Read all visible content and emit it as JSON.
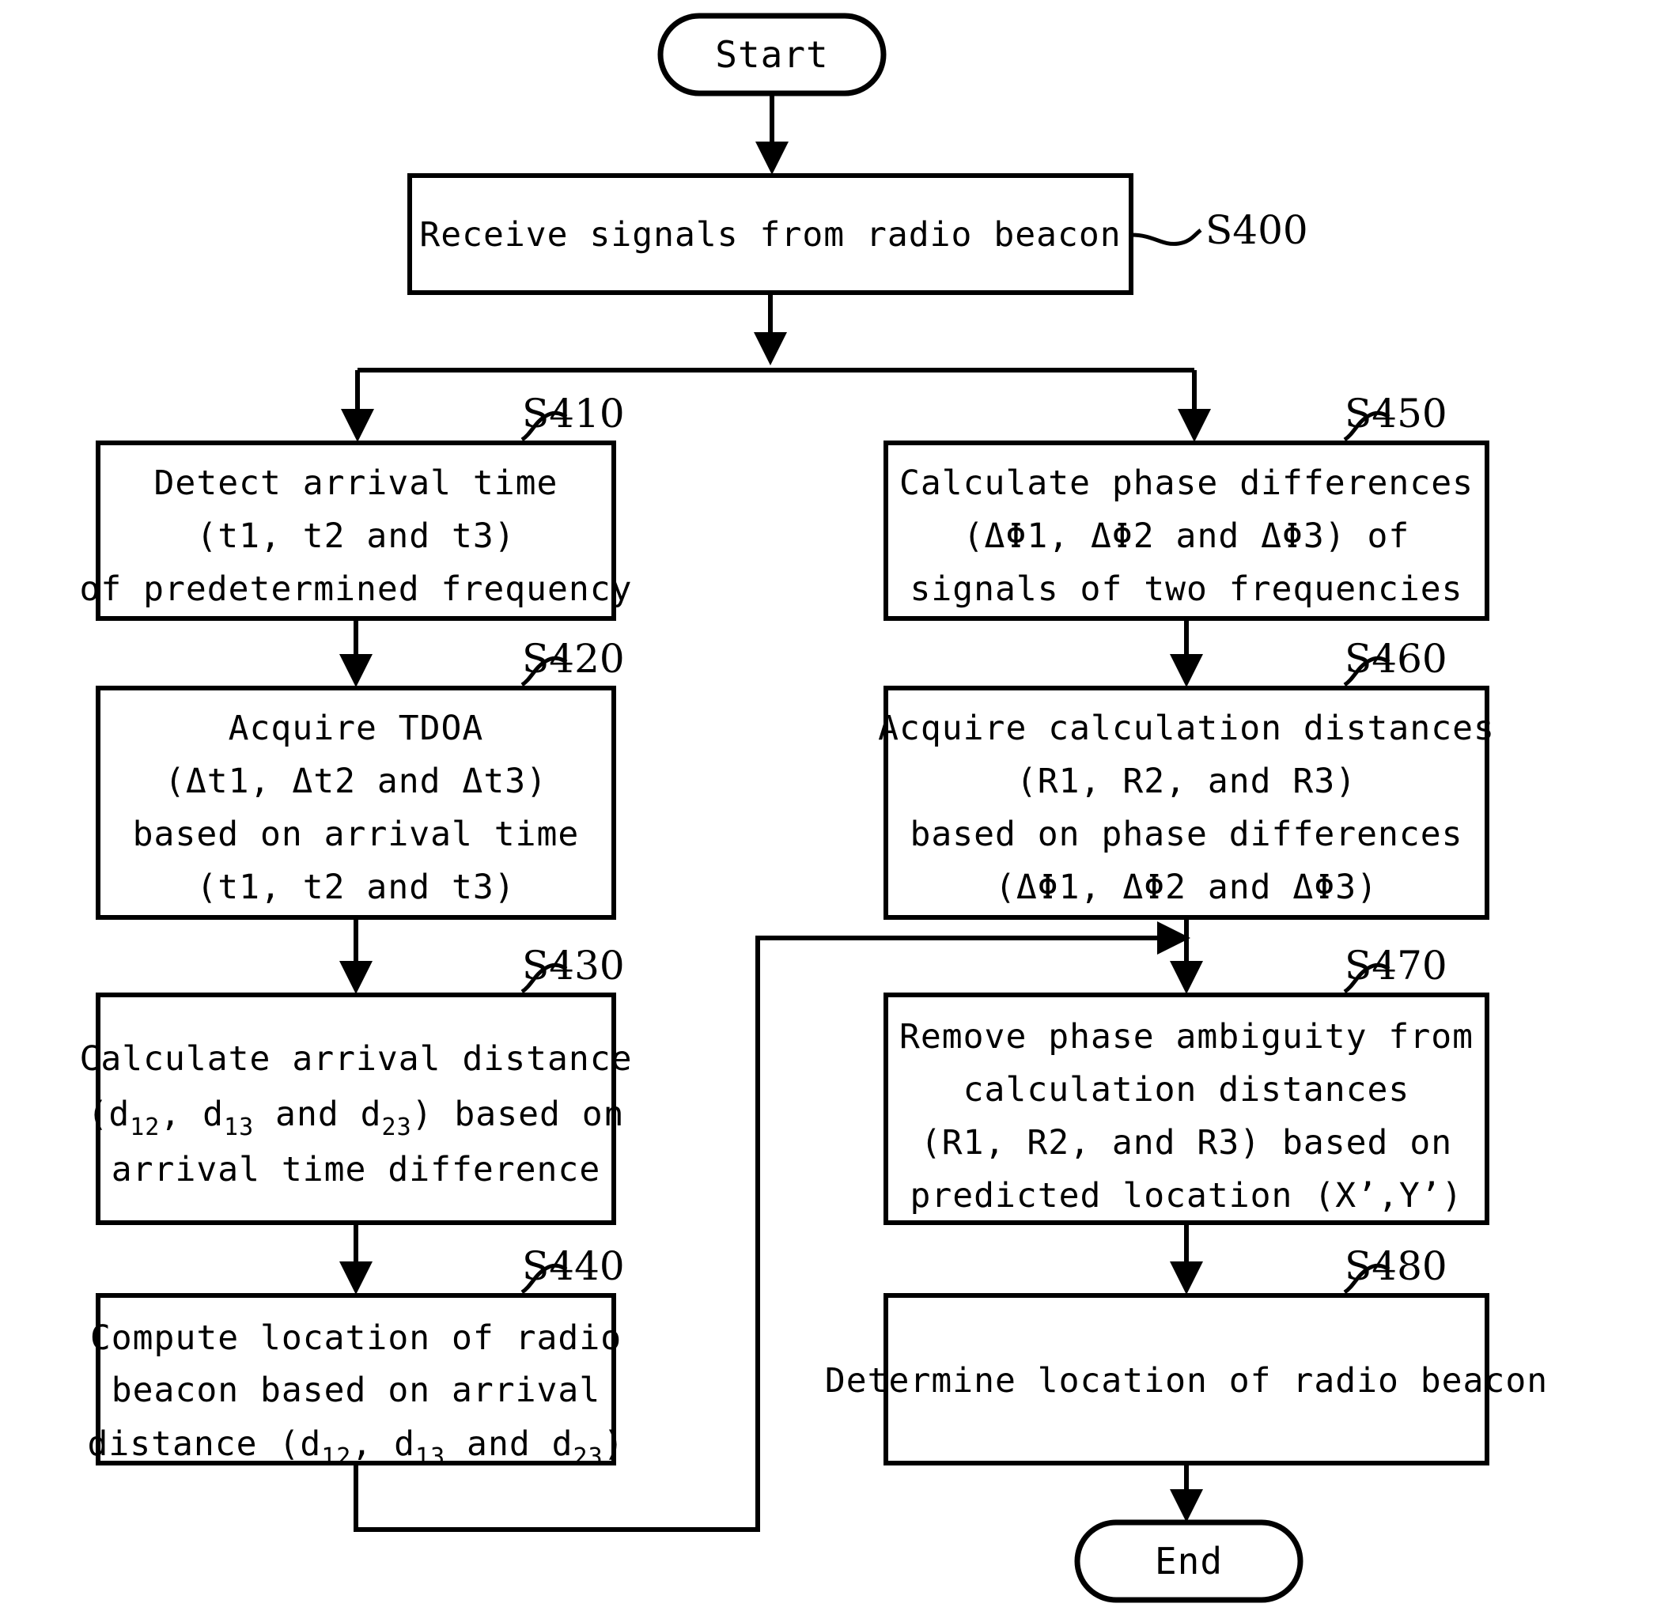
{
  "diagram": {
    "title": "Radio beacon location determination flowchart",
    "colors": {
      "stroke": "#000000",
      "fill": "#ffffff",
      "text": "#000000"
    },
    "terminals": {
      "start": "Start",
      "end": "End"
    },
    "nodes": [
      {
        "id": "S400",
        "label": "S400",
        "lines": [
          "Receive signals from radio beacon"
        ]
      },
      {
        "id": "S410",
        "label": "S410",
        "lines": [
          "Detect arrival time",
          "(t1, t2 and t3)",
          "of predetermined frequency"
        ]
      },
      {
        "id": "S420",
        "label": "S420",
        "lines": [
          "Acquire TDOA",
          "(Δt1,  Δt2 and Δt3)",
          "based on arrival time",
          "(t1,  t2 and t3)"
        ]
      },
      {
        "id": "S430",
        "label": "S430",
        "lines": [
          "Calculate arrival distance",
          "(d12,  d13 and d23) based on",
          "arrival time difference"
        ],
        "rich": [
          [
            {
              "t": "Calculate arrival distance"
            }
          ],
          [
            {
              "t": "(d"
            },
            {
              "t": "12",
              "sub": true
            },
            {
              "t": ",  d"
            },
            {
              "t": "13",
              "sub": true
            },
            {
              "t": " and d"
            },
            {
              "t": "23",
              "sub": true
            },
            {
              "t": ") based on"
            }
          ],
          [
            {
              "t": "arrival time difference"
            }
          ]
        ]
      },
      {
        "id": "S440",
        "label": "S440",
        "lines": [
          "Compute location of radio",
          "beacon based on arrival",
          "distance (d12,  d13 and d23)"
        ],
        "rich": [
          [
            {
              "t": "Compute location of radio"
            }
          ],
          [
            {
              "t": "beacon based on arrival"
            }
          ],
          [
            {
              "t": "distance (d"
            },
            {
              "t": "12",
              "sub": true
            },
            {
              "t": ",  d"
            },
            {
              "t": "13",
              "sub": true
            },
            {
              "t": " and d"
            },
            {
              "t": "23",
              "sub": true
            },
            {
              "t": ")"
            }
          ]
        ]
      },
      {
        "id": "S450",
        "label": "S450",
        "lines": [
          "Calculate phase differences",
          "(ΔΦ1,  ΔΦ2 and ΔΦ3) of",
          "signals of two frequencies"
        ]
      },
      {
        "id": "S460",
        "label": "S460",
        "lines": [
          "Acquire calculation distances",
          "(R1, R2, and R3)",
          "based on phase differences",
          "(ΔΦ1,  ΔΦ2 and ΔΦ3)"
        ]
      },
      {
        "id": "S470",
        "label": "S470",
        "lines": [
          "Remove phase ambiguity from",
          "calculation distances",
          "(R1, R2, and R3) based on",
          "predicted location (X’,Y’)"
        ]
      },
      {
        "id": "S480",
        "label": "S480",
        "lines": [
          "Determine location of radio beacon"
        ]
      }
    ]
  }
}
